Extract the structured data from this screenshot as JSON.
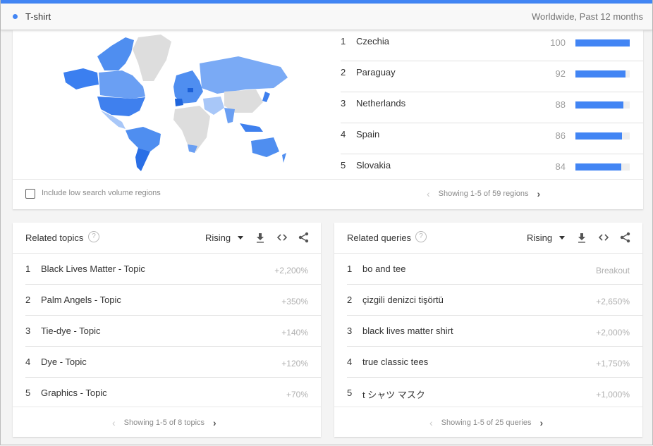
{
  "header": {
    "term": "T-shirt",
    "term_color": "#4285f4",
    "scope": "Worldwide, Past 12 months"
  },
  "regions": {
    "items": [
      {
        "rank": "1",
        "name": "Czechia",
        "value": 100
      },
      {
        "rank": "2",
        "name": "Paraguay",
        "value": 92
      },
      {
        "rank": "3",
        "name": "Netherlands",
        "value": 88
      },
      {
        "rank": "4",
        "name": "Spain",
        "value": 86
      },
      {
        "rank": "5",
        "name": "Slovakia",
        "value": 84
      }
    ],
    "include_low_volume_label": "Include low search volume regions",
    "include_low_volume_checked": false,
    "pager_text": "Showing 1-5 of 59 regions",
    "prev_icon": "chevron-left-icon",
    "next_icon": "chevron-right-icon"
  },
  "related_topics": {
    "title": "Related topics",
    "filter": "Rising",
    "items": [
      {
        "rank": "1",
        "label": "Black Lives Matter - Topic",
        "value": "+2,200%"
      },
      {
        "rank": "2",
        "label": "Palm Angels - Topic",
        "value": "+350%"
      },
      {
        "rank": "3",
        "label": "Tie-dye - Topic",
        "value": "+140%"
      },
      {
        "rank": "4",
        "label": "Dye - Topic",
        "value": "+120%"
      },
      {
        "rank": "5",
        "label": "Graphics - Topic",
        "value": "+70%"
      }
    ],
    "pager_text": "Showing 1-5 of 8 topics"
  },
  "related_queries": {
    "title": "Related queries",
    "filter": "Rising",
    "items": [
      {
        "rank": "1",
        "label": "bo and tee",
        "value": "Breakout"
      },
      {
        "rank": "2",
        "label": "çizgili denizci tişörtü",
        "value": "+2,650%"
      },
      {
        "rank": "3",
        "label": "black lives matter shirt",
        "value": "+2,000%"
      },
      {
        "rank": "4",
        "label": "true classic tees",
        "value": "+1,750%"
      },
      {
        "rank": "5",
        "label": "t シャツ マスク",
        "value": "+1,000%"
      }
    ],
    "pager_text": "Showing 1-5 of 25 queries"
  },
  "icons": {
    "help": "?",
    "prev": "‹",
    "next": "›"
  },
  "colors": {
    "accent": "#4285f4",
    "map_high": "#2a6fe6",
    "map_mid": "#4f8ef0",
    "map_low": "#8ab4f8",
    "map_none": "#dddddd"
  }
}
